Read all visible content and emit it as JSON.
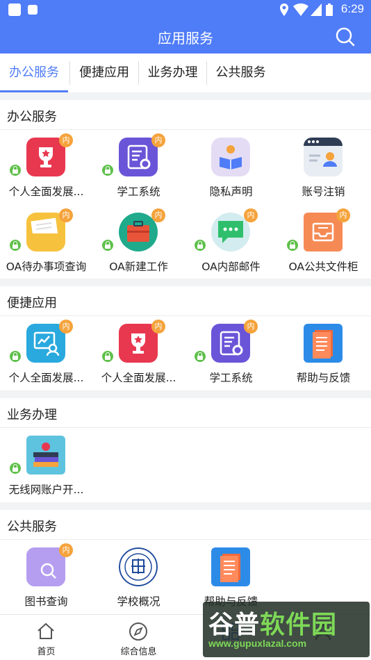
{
  "status_bar": {
    "time": "6:29"
  },
  "app_bar": {
    "title": "应用服务"
  },
  "tabs": [
    {
      "label": "办公服务",
      "active": true
    },
    {
      "label": "便捷应用",
      "active": false
    },
    {
      "label": "业务办理",
      "active": false
    },
    {
      "label": "公共服务",
      "active": false
    }
  ],
  "sections": [
    {
      "title": "办公服务",
      "items": [
        {
          "label": "个人全面发展...",
          "icon": "trophy-icon",
          "locked": true,
          "badge": "内"
        },
        {
          "label": "学工系统",
          "icon": "settings-form-icon",
          "locked": true,
          "badge": "内"
        },
        {
          "label": "隐私声明",
          "icon": "reader-icon",
          "locked": false,
          "badge": ""
        },
        {
          "label": "账号注销",
          "icon": "user-window-icon",
          "locked": false,
          "badge": ""
        },
        {
          "label": "OA待办事项查询",
          "icon": "todo-folder-icon",
          "locked": true,
          "badge": "内"
        },
        {
          "label": "OA新建工作",
          "icon": "briefcase-icon",
          "locked": true,
          "badge": "内"
        },
        {
          "label": "OA内部邮件",
          "icon": "chat-bubble-icon",
          "locked": true,
          "badge": "内"
        },
        {
          "label": "OA公共文件柜",
          "icon": "file-cabinet-icon",
          "locked": true,
          "badge": "内"
        }
      ]
    },
    {
      "title": "便捷应用",
      "items": [
        {
          "label": "个人全面发展...",
          "icon": "growth-chart-icon",
          "locked": true,
          "badge": "内"
        },
        {
          "label": "个人全面发展...",
          "icon": "trophy-icon",
          "locked": true,
          "badge": "内"
        },
        {
          "label": "学工系统",
          "icon": "settings-form-icon",
          "locked": true,
          "badge": "内"
        },
        {
          "label": "帮助与反馈",
          "icon": "help-doc-icon",
          "locked": false,
          "badge": ""
        }
      ]
    },
    {
      "title": "业务办理",
      "items": [
        {
          "label": "无线网账户开...",
          "icon": "books-apple-icon",
          "locked": true,
          "badge": ""
        }
      ]
    },
    {
      "title": "公共服务",
      "items": [
        {
          "label": "图书查询",
          "icon": "book-search-icon",
          "locked": false,
          "badge": "内"
        },
        {
          "label": "学校概况",
          "icon": "university-seal-icon",
          "locked": false,
          "badge": ""
        },
        {
          "label": "帮助与反馈",
          "icon": "help-doc-icon",
          "locked": false,
          "badge": ""
        }
      ]
    }
  ],
  "bottom_nav": [
    {
      "label": "首页",
      "icon": "home-icon"
    },
    {
      "label": "综合信息",
      "icon": "compass-icon"
    },
    {
      "label": "",
      "icon": "apps-icon"
    },
    {
      "label": "",
      "icon": "profile-icon"
    }
  ],
  "watermark": {
    "title_white": "谷普",
    "title_green": "软件园",
    "url": "www.gupuxlazal.com"
  }
}
